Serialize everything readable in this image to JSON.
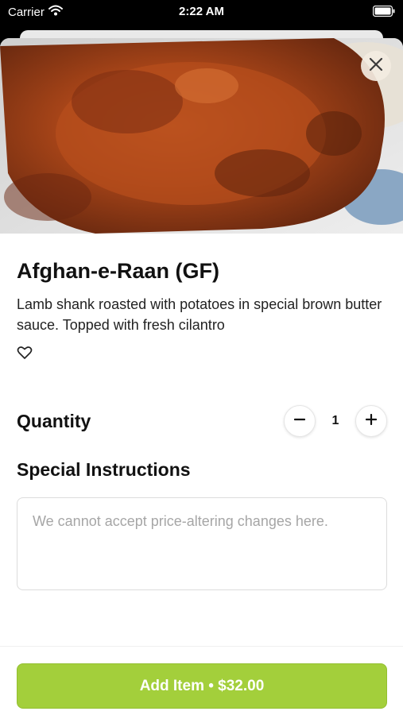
{
  "status_bar": {
    "carrier": "Carrier",
    "time": "2:22 AM"
  },
  "item": {
    "title": "Afghan-e-Raan (GF)",
    "description": "Lamb shank roasted with potatoes in special brown butter sauce. Topped with fresh cilantro"
  },
  "quantity": {
    "label": "Quantity",
    "value": "1"
  },
  "special_instructions": {
    "label": "Special Instructions",
    "placeholder": "We cannot accept price-altering changes here."
  },
  "footer": {
    "add_label": "Add Item • $32.00"
  },
  "colors": {
    "accent": "#a3cf3b",
    "sheet_bg": "#ffffff",
    "placeholder": "#a6a6a6"
  },
  "icons": [
    "wifi-icon",
    "battery-icon",
    "close-icon",
    "heart-icon",
    "minus-icon",
    "plus-icon"
  ]
}
